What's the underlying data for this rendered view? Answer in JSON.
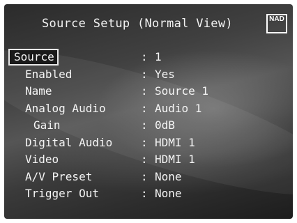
{
  "header": {
    "title": "Source Setup (Normal View)",
    "logo_text": "NAD"
  },
  "menu": {
    "selected_index": 0,
    "items": [
      {
        "label": "Source",
        "value": "1"
      },
      {
        "label": "Enabled",
        "value": "Yes"
      },
      {
        "label": "Name",
        "value": "Source 1"
      },
      {
        "label": "Analog Audio",
        "value": "Audio 1"
      },
      {
        "label": "Gain",
        "value": "0dB"
      },
      {
        "label": "Digital Audio",
        "value": "HDMI 1"
      },
      {
        "label": "Video",
        "value": "HDMI 1"
      },
      {
        "label": "A/V Preset",
        "value": "None"
      },
      {
        "label": "Trigger Out",
        "value": "None"
      }
    ]
  }
}
